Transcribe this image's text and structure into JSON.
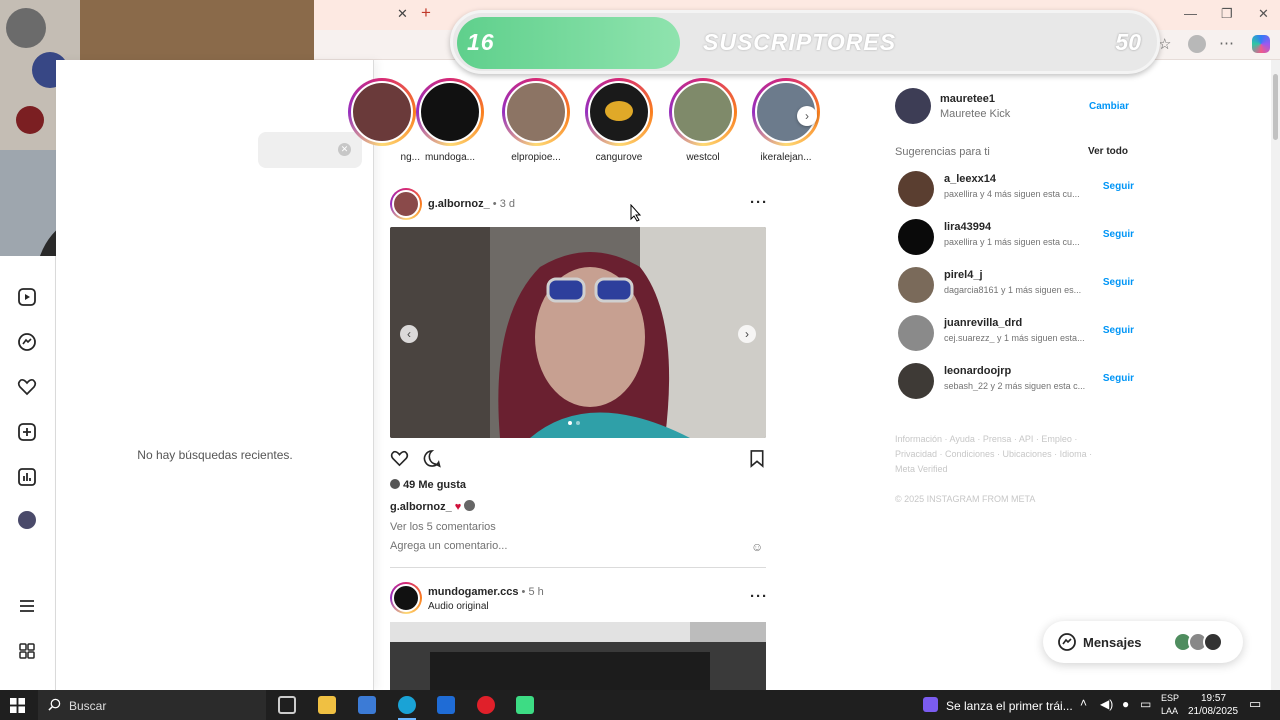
{
  "overlay": {
    "subscriber_count": "16",
    "label": "SUSCRIPTORES",
    "goal": "50",
    "progress_fraction": 0.32
  },
  "search_panel": {
    "empty_message": "No hay búsquedas recientes."
  },
  "stories": [
    {
      "name": "ng..."
    },
    {
      "name": "mundoga..."
    },
    {
      "name": "elpropioe..."
    },
    {
      "name": "cangurove"
    },
    {
      "name": "westcol"
    },
    {
      "name": "ikeralejan..."
    }
  ],
  "posts": [
    {
      "user": "g.albornoz_",
      "time": "• 3 d",
      "likes": "49 Me gusta",
      "caption_user": "g.albornoz_",
      "caption_emoji": "♥",
      "view_comments": "Ver los 5 comentarios",
      "add_comment_placeholder": "Agrega un comentario..."
    },
    {
      "user": "mundogamer.ccs",
      "time": "• 5 h",
      "subtitle": "Audio original"
    }
  ],
  "account": {
    "username": "mauretee1",
    "display_name": "Mauretee Kick",
    "switch_label": "Cambiar"
  },
  "suggestions": {
    "title": "Sugerencias para ti",
    "see_all": "Ver todo",
    "follow_label": "Seguir",
    "items": [
      {
        "username": "a_leexx14",
        "subtitle": "paxellira y 4 más siguen esta cu..."
      },
      {
        "username": "lira43994",
        "subtitle": "paxellira y 1 más siguen esta cu..."
      },
      {
        "username": "pirel4_j",
        "subtitle": "dagarcia8161 y 1 más siguen es..."
      },
      {
        "username": "juanrevilla_drd",
        "subtitle": "cej.suarezz_ y 1 más siguen esta..."
      },
      {
        "username": "leonardoojrp",
        "subtitle": "sebash_22 y 2 más siguen esta c..."
      }
    ]
  },
  "footer": {
    "line1": "Información · Ayuda · Prensa · API · Empleo ·",
    "line2": "Privacidad · Condiciones · Ubicaciones · Idioma ·",
    "line3": "Meta Verified",
    "copyright": "© 2025 INSTAGRAM FROM META"
  },
  "messages": {
    "label": "Mensajes"
  },
  "taskbar": {
    "search_placeholder": "Buscar",
    "notification_text": "Se lanza el primer trái...",
    "lang_top": "ESP",
    "lang_bottom": "LAA",
    "time": "19:57",
    "date": "21/08/2025"
  },
  "colors": {
    "accent": "#0095f6",
    "overlay_green": "#5fd08c",
    "taskbar": "#1f1f1f"
  }
}
